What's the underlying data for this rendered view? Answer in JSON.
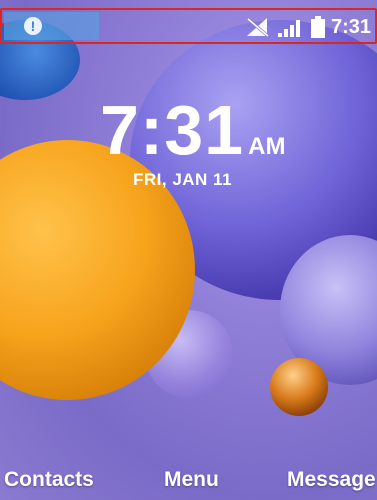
{
  "statusbar": {
    "time": "7:31",
    "icons": [
      "alert-icon",
      "no-sim-icon",
      "signal-icon",
      "battery-icon"
    ],
    "alert_glyph": "!"
  },
  "lockscreen": {
    "time": "7:31",
    "ampm": "AM",
    "date": "FRI, JAN 11"
  },
  "softkeys": {
    "left": "Contacts",
    "center": "Menu",
    "right": "Message"
  },
  "colors": {
    "highlight": "#d9281f",
    "orange_sphere": "#f7a41d",
    "background": "#8f7fd8"
  }
}
